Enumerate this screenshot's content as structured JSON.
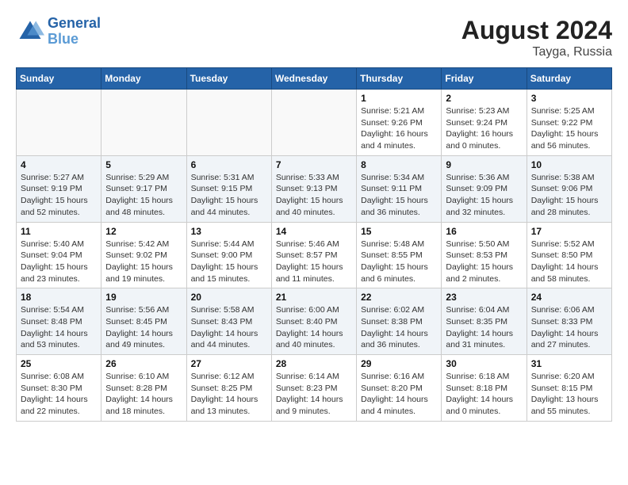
{
  "header": {
    "logo_line1": "General",
    "logo_line2": "Blue",
    "month_year": "August 2024",
    "location": "Tayga, Russia"
  },
  "weekdays": [
    "Sunday",
    "Monday",
    "Tuesday",
    "Wednesday",
    "Thursday",
    "Friday",
    "Saturday"
  ],
  "weeks": [
    [
      {
        "day": "",
        "info": ""
      },
      {
        "day": "",
        "info": ""
      },
      {
        "day": "",
        "info": ""
      },
      {
        "day": "",
        "info": ""
      },
      {
        "day": "1",
        "info": "Sunrise: 5:21 AM\nSunset: 9:26 PM\nDaylight: 16 hours\nand 4 minutes."
      },
      {
        "day": "2",
        "info": "Sunrise: 5:23 AM\nSunset: 9:24 PM\nDaylight: 16 hours\nand 0 minutes."
      },
      {
        "day": "3",
        "info": "Sunrise: 5:25 AM\nSunset: 9:22 PM\nDaylight: 15 hours\nand 56 minutes."
      }
    ],
    [
      {
        "day": "4",
        "info": "Sunrise: 5:27 AM\nSunset: 9:19 PM\nDaylight: 15 hours\nand 52 minutes."
      },
      {
        "day": "5",
        "info": "Sunrise: 5:29 AM\nSunset: 9:17 PM\nDaylight: 15 hours\nand 48 minutes."
      },
      {
        "day": "6",
        "info": "Sunrise: 5:31 AM\nSunset: 9:15 PM\nDaylight: 15 hours\nand 44 minutes."
      },
      {
        "day": "7",
        "info": "Sunrise: 5:33 AM\nSunset: 9:13 PM\nDaylight: 15 hours\nand 40 minutes."
      },
      {
        "day": "8",
        "info": "Sunrise: 5:34 AM\nSunset: 9:11 PM\nDaylight: 15 hours\nand 36 minutes."
      },
      {
        "day": "9",
        "info": "Sunrise: 5:36 AM\nSunset: 9:09 PM\nDaylight: 15 hours\nand 32 minutes."
      },
      {
        "day": "10",
        "info": "Sunrise: 5:38 AM\nSunset: 9:06 PM\nDaylight: 15 hours\nand 28 minutes."
      }
    ],
    [
      {
        "day": "11",
        "info": "Sunrise: 5:40 AM\nSunset: 9:04 PM\nDaylight: 15 hours\nand 23 minutes."
      },
      {
        "day": "12",
        "info": "Sunrise: 5:42 AM\nSunset: 9:02 PM\nDaylight: 15 hours\nand 19 minutes."
      },
      {
        "day": "13",
        "info": "Sunrise: 5:44 AM\nSunset: 9:00 PM\nDaylight: 15 hours\nand 15 minutes."
      },
      {
        "day": "14",
        "info": "Sunrise: 5:46 AM\nSunset: 8:57 PM\nDaylight: 15 hours\nand 11 minutes."
      },
      {
        "day": "15",
        "info": "Sunrise: 5:48 AM\nSunset: 8:55 PM\nDaylight: 15 hours\nand 6 minutes."
      },
      {
        "day": "16",
        "info": "Sunrise: 5:50 AM\nSunset: 8:53 PM\nDaylight: 15 hours\nand 2 minutes."
      },
      {
        "day": "17",
        "info": "Sunrise: 5:52 AM\nSunset: 8:50 PM\nDaylight: 14 hours\nand 58 minutes."
      }
    ],
    [
      {
        "day": "18",
        "info": "Sunrise: 5:54 AM\nSunset: 8:48 PM\nDaylight: 14 hours\nand 53 minutes."
      },
      {
        "day": "19",
        "info": "Sunrise: 5:56 AM\nSunset: 8:45 PM\nDaylight: 14 hours\nand 49 minutes."
      },
      {
        "day": "20",
        "info": "Sunrise: 5:58 AM\nSunset: 8:43 PM\nDaylight: 14 hours\nand 44 minutes."
      },
      {
        "day": "21",
        "info": "Sunrise: 6:00 AM\nSunset: 8:40 PM\nDaylight: 14 hours\nand 40 minutes."
      },
      {
        "day": "22",
        "info": "Sunrise: 6:02 AM\nSunset: 8:38 PM\nDaylight: 14 hours\nand 36 minutes."
      },
      {
        "day": "23",
        "info": "Sunrise: 6:04 AM\nSunset: 8:35 PM\nDaylight: 14 hours\nand 31 minutes."
      },
      {
        "day": "24",
        "info": "Sunrise: 6:06 AM\nSunset: 8:33 PM\nDaylight: 14 hours\nand 27 minutes."
      }
    ],
    [
      {
        "day": "25",
        "info": "Sunrise: 6:08 AM\nSunset: 8:30 PM\nDaylight: 14 hours\nand 22 minutes."
      },
      {
        "day": "26",
        "info": "Sunrise: 6:10 AM\nSunset: 8:28 PM\nDaylight: 14 hours\nand 18 minutes."
      },
      {
        "day": "27",
        "info": "Sunrise: 6:12 AM\nSunset: 8:25 PM\nDaylight: 14 hours\nand 13 minutes."
      },
      {
        "day": "28",
        "info": "Sunrise: 6:14 AM\nSunset: 8:23 PM\nDaylight: 14 hours\nand 9 minutes."
      },
      {
        "day": "29",
        "info": "Sunrise: 6:16 AM\nSunset: 8:20 PM\nDaylight: 14 hours\nand 4 minutes."
      },
      {
        "day": "30",
        "info": "Sunrise: 6:18 AM\nSunset: 8:18 PM\nDaylight: 14 hours\nand 0 minutes."
      },
      {
        "day": "31",
        "info": "Sunrise: 6:20 AM\nSunset: 8:15 PM\nDaylight: 13 hours\nand 55 minutes."
      }
    ]
  ]
}
